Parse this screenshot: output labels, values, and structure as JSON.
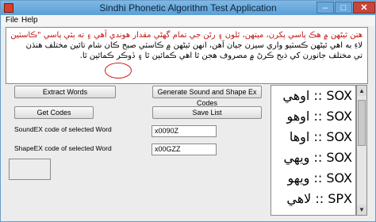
{
  "window": {
    "title": "Sindhi Phonetic Algorithm Test Application",
    "minimize": "–",
    "maximize": "□",
    "close": "✕"
  },
  "menu": {
    "file": "File",
    "help": "Help"
  },
  "input_text": {
    "line1": "هتن ٿيڻهن ۾ هڪ پاسي پکرن، ميتهن، ٿلون ۽ رڻن جي تمام گهڻي مقدار هوندي آهي ۽ ته ٻئي پاسي \"ڪاسٽين",
    "line2": "لاءِ به اهي ٿيڻهن ڪسٽيو واري سيزن جيان آهن، انهن ٿيڻهن ۾ ڪاسٽي صبح ڪان شام تائين مختلف هنڌن",
    "line3_start": "تي مختلف جانورن کي ذبح ڪرڻ ۾ مصروف هجن ٿا ",
    "line3_word": "اهي",
    "line3_end": " ڪمائين ٿا ۽ ڏوڪر ڪمائين ٿا."
  },
  "buttons": {
    "extract": "Extract Words",
    "generate": "Generate Sound and Shape Ex Codes",
    "get_codes": "Get Codes",
    "save_list": "Save List"
  },
  "fields": {
    "soundex_label": "SoundEX code of selected Word",
    "soundex_value": "x0090Z",
    "shapeex_label": "ShapeEX code of selected Word",
    "shapeex_value": "x00GZZ"
  },
  "list_items": [
    {
      "word": "اوهي",
      "code": "SOX"
    },
    {
      "word": "اوهو",
      "code": "SOX"
    },
    {
      "word": "اوها",
      "code": "SOX"
    },
    {
      "word": "ويهي",
      "code": "SOX"
    },
    {
      "word": "ويهو",
      "code": "SOX"
    },
    {
      "word": "لاهي",
      "code": "SPX"
    }
  ],
  "list_separator": "::",
  "colors": {
    "titlebar": "#5a9fd6",
    "highlight": "#c01616"
  }
}
